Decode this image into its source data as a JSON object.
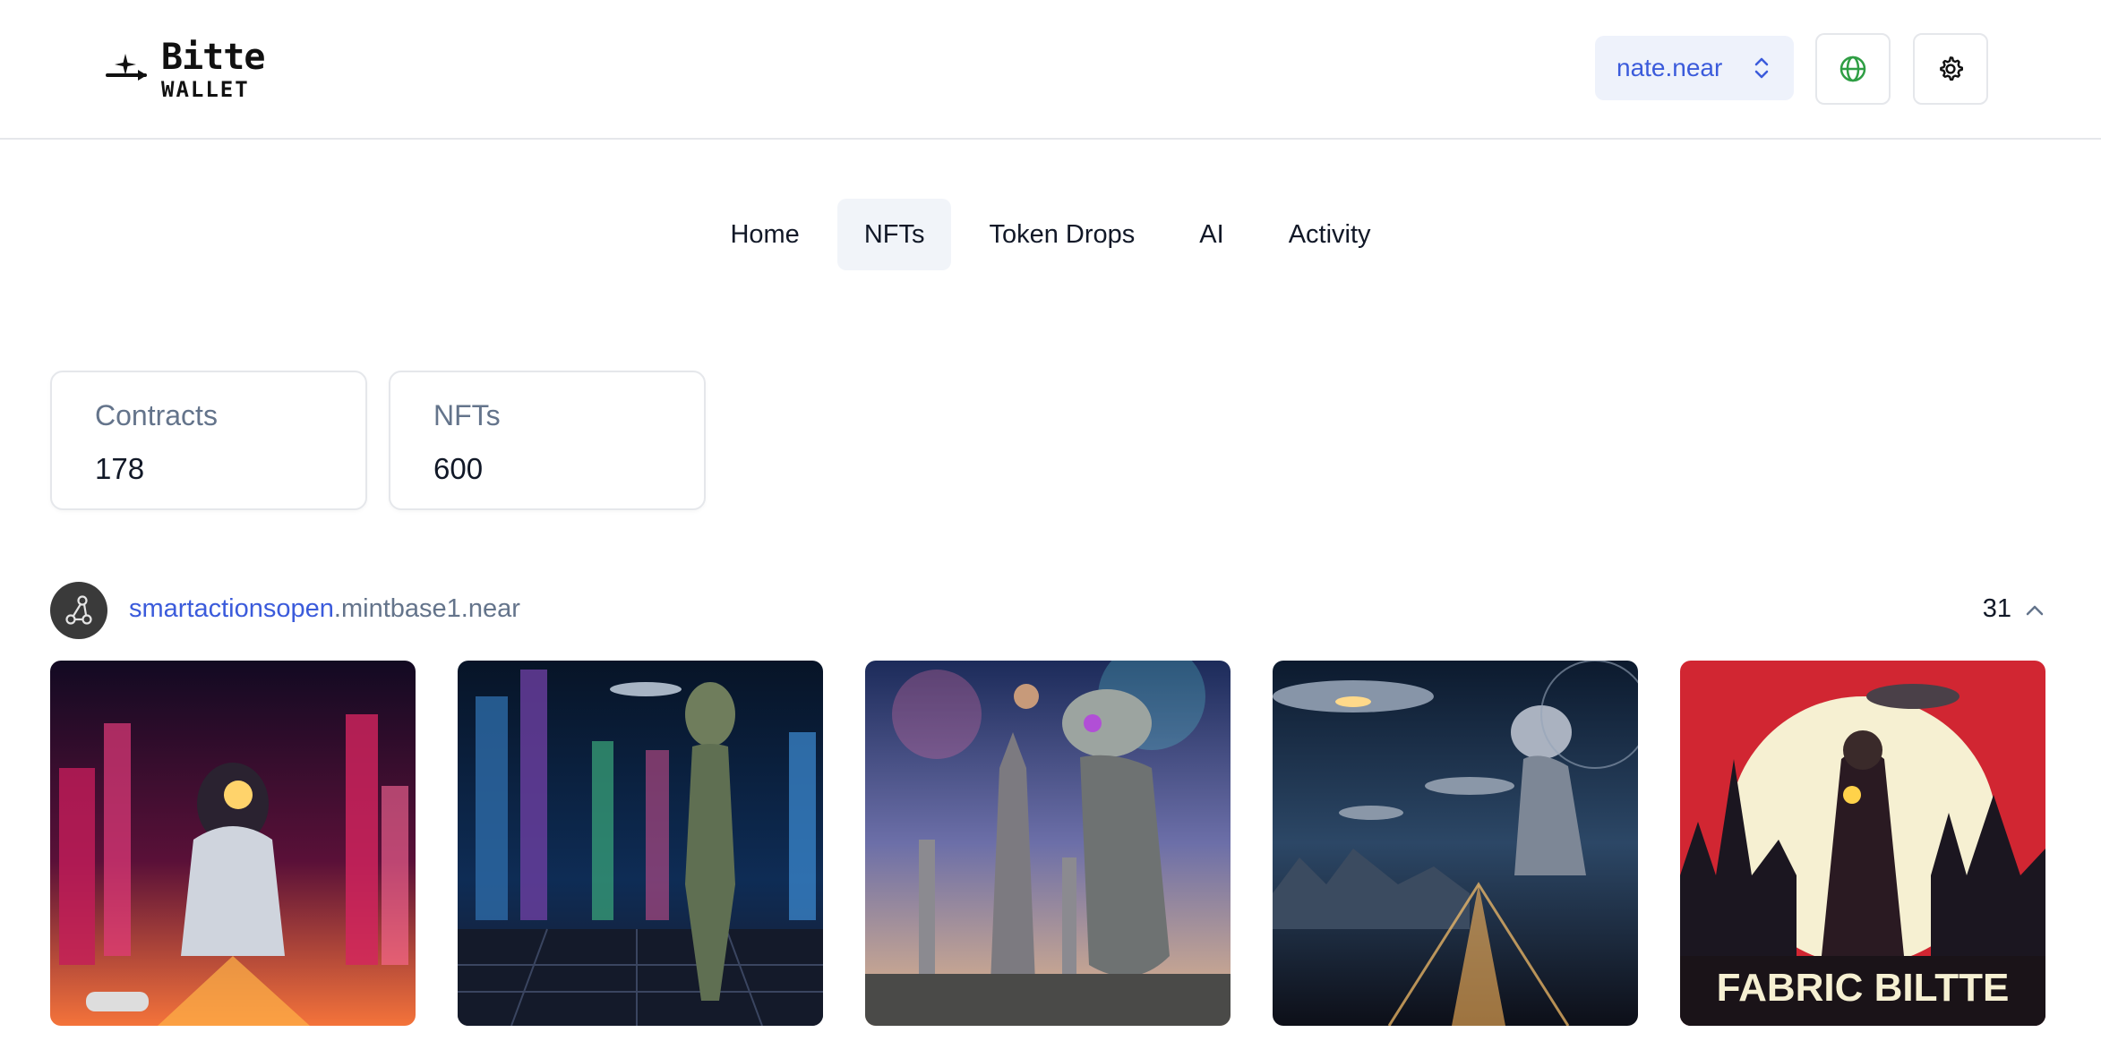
{
  "header": {
    "logo_brand": "Bitte",
    "logo_sub": "WALLET",
    "account": "nate.near"
  },
  "tabs": [
    {
      "label": "Home",
      "active": false
    },
    {
      "label": "NFTs",
      "active": true
    },
    {
      "label": "Token Drops",
      "active": false
    },
    {
      "label": "AI",
      "active": false
    },
    {
      "label": "Activity",
      "active": false
    }
  ],
  "stats": {
    "contracts": {
      "label": "Contracts",
      "value": "178"
    },
    "nfts": {
      "label": "NFTs",
      "value": "600"
    }
  },
  "collection": {
    "name_primary": "smartactionsopen",
    "name_suffix": ".mintbase1.near",
    "count": "31",
    "items": [
      {
        "poster_title": "FABRIC BILTTE"
      }
    ]
  },
  "colors": {
    "accent": "#3b5bdb",
    "muted": "#64748b",
    "tab_active_bg": "#f1f4f9",
    "globe": "#2f9e44"
  },
  "icons": [
    "sparkle-arrow-icon",
    "chevron-up-down-icon",
    "globe-icon",
    "gear-icon",
    "network-icon",
    "chevron-up-icon"
  ]
}
